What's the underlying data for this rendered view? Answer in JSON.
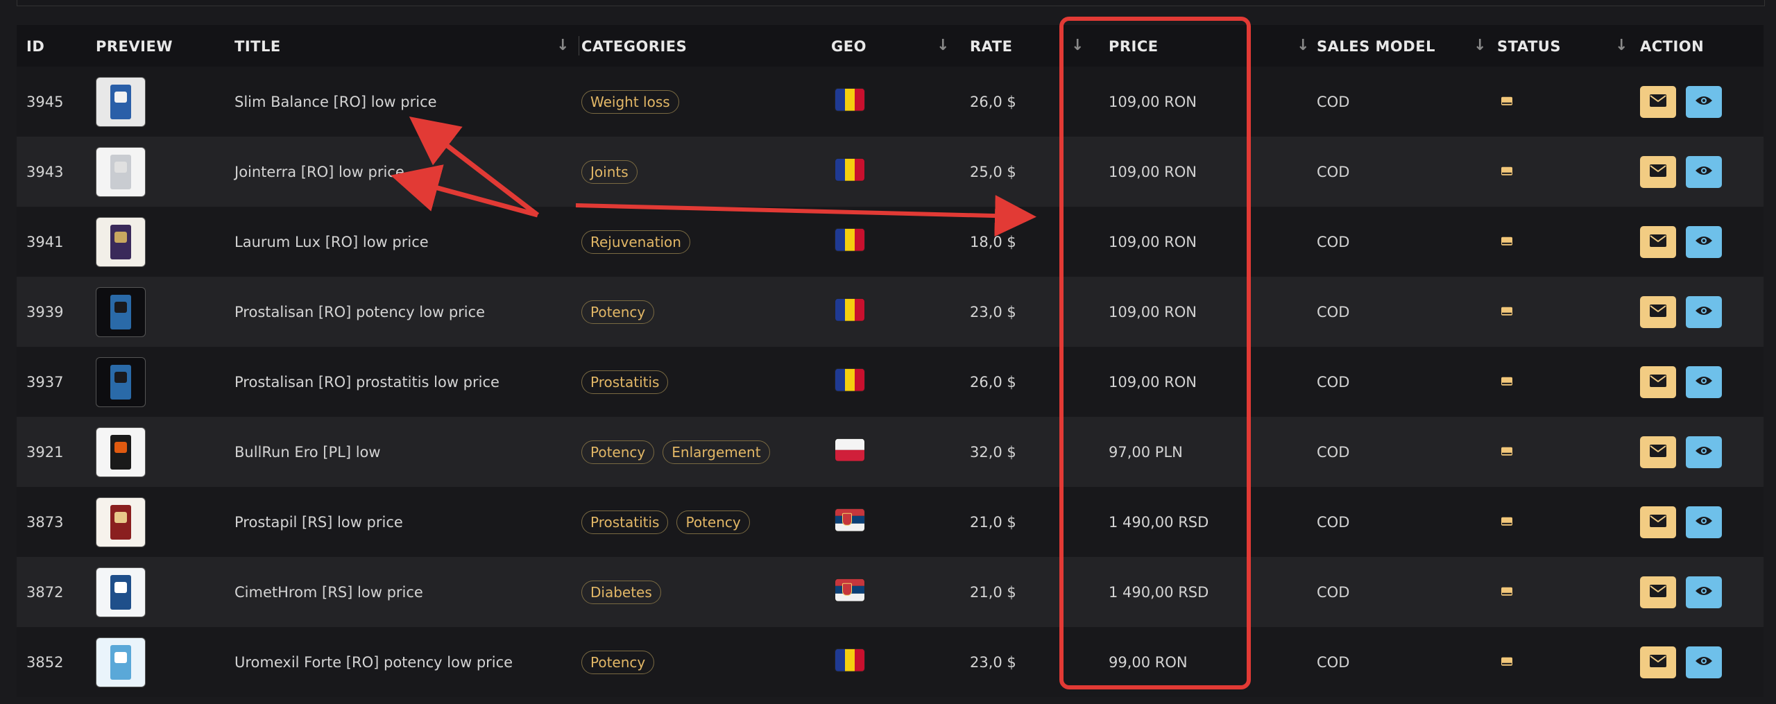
{
  "headers": {
    "id": "ID",
    "preview": "PREVIEW",
    "title": "TITLE",
    "categories": "CATEGORIES",
    "geo": "GEO",
    "rate": "RATE",
    "price": "PRICE",
    "sales_model": "SALES MODEL",
    "status": "STATUS",
    "action": "ACTION"
  },
  "icons": {
    "sort": "arrow-down-icon",
    "status": "envelope-icon",
    "action_mail": "envelope-icon",
    "action_view": "eye-icon"
  },
  "colors": {
    "tag_text": "#e2b766",
    "mail_button": "#f2cc83",
    "view_button": "#6ec0ea",
    "annotation": "#e23a35"
  },
  "rows": [
    {
      "id": "3945",
      "title": "Slim Balance [RO] low price",
      "categories": [
        "Weight loss"
      ],
      "geo": "RO",
      "rate": "26,0 $",
      "price": "109,00 RON",
      "sales_model": "COD"
    },
    {
      "id": "3943",
      "title": "Jointerra [RO] low price",
      "categories": [
        "Joints"
      ],
      "geo": "RO",
      "rate": "25,0 $",
      "price": "109,00 RON",
      "sales_model": "COD"
    },
    {
      "id": "3941",
      "title": "Laurum Lux [RO] low price",
      "categories": [
        "Rejuvenation"
      ],
      "geo": "RO",
      "rate": "18,0 $",
      "price": "109,00 RON",
      "sales_model": "COD"
    },
    {
      "id": "3939",
      "title": "Prostalisan [RO] potency low price",
      "categories": [
        "Potency"
      ],
      "geo": "RO",
      "rate": "23,0 $",
      "price": "109,00 RON",
      "sales_model": "COD"
    },
    {
      "id": "3937",
      "title": "Prostalisan [RO] prostatitis low price",
      "categories": [
        "Prostatitis"
      ],
      "geo": "RO",
      "rate": "26,0 $",
      "price": "109,00 RON",
      "sales_model": "COD"
    },
    {
      "id": "3921",
      "title": "BullRun Ero [PL] low",
      "categories": [
        "Potency",
        "Enlargement"
      ],
      "geo": "PL",
      "rate": "32,0 $",
      "price": "97,00 PLN",
      "sales_model": "COD"
    },
    {
      "id": "3873",
      "title": "Prostapil [RS] low price",
      "categories": [
        "Prostatitis",
        "Potency"
      ],
      "geo": "RS",
      "rate": "21,0 $",
      "price": "1 490,00 RSD",
      "sales_model": "COD"
    },
    {
      "id": "3872",
      "title": "CimetHrom [RS] low price",
      "categories": [
        "Diabetes"
      ],
      "geo": "RS",
      "rate": "21,0 $",
      "price": "1 490,00 RSD",
      "sales_model": "COD"
    },
    {
      "id": "3852",
      "title": "Uromexil Forte [RO] potency low price",
      "categories": [
        "Potency"
      ],
      "geo": "RO",
      "rate": "23,0 $",
      "price": "99,00 RON",
      "sales_model": "COD"
    }
  ]
}
